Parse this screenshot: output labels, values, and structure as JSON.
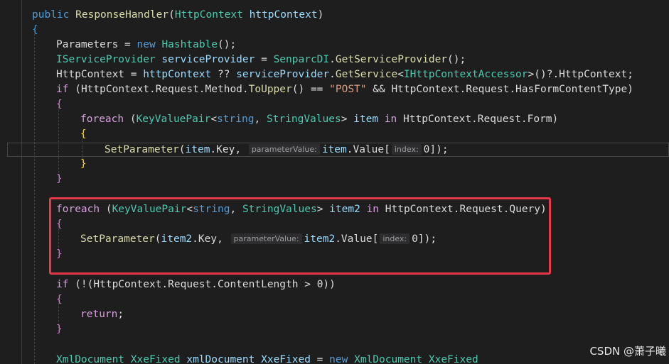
{
  "editor": {
    "line1": {
      "kw": "public",
      "name": "ResponseHandler",
      "open": "(",
      "ptype": "HttpContext",
      "pname": "httpContext",
      "close": ")"
    },
    "line2": "{",
    "line3": {
      "a": "Parameters",
      "eq": " = ",
      "kw": "new",
      "type": "Hashtable",
      "rest": "();"
    },
    "line4": {
      "type": "IServiceProvider",
      "var": "serviceProvider",
      "eq": " = ",
      "cls": "SenparcDI",
      "dot": ".",
      "method": "GetServiceProvider",
      "rest": "();"
    },
    "line5": {
      "a": "HttpContext",
      "eq": " = ",
      "b": "httpContext",
      "op": " ?? ",
      "c": "serviceProvider",
      "dot": ".",
      "method": "GetService",
      "lt": "<",
      "type": "IHttpContextAccessor",
      "gt": ">",
      "rest": "()?.HttpContext;"
    },
    "line6": {
      "kw": "if",
      "open": " (",
      "a": "HttpContext.Request.Method.",
      "method": "ToUpper",
      "paren": "()",
      "op": " == ",
      "str": "\"POST\"",
      "and": " && ",
      "b": "HttpContext.Request.HasFormContentType",
      "close": ")"
    },
    "line7": "{",
    "line8": {
      "kw": "foreach",
      "open": " (",
      "type": "KeyValuePair",
      "lt": "<",
      "t1": "string",
      "comma": ", ",
      "t2": "StringValues",
      "gt": ">",
      "var": " item",
      "in": " in",
      "rest": " HttpContext.Request.Form",
      "close": ")"
    },
    "line9": "{",
    "line10": {
      "method": "SetParameter",
      "open": "(",
      "a": "item",
      "key": ".Key, ",
      "hint1": "parameterValue:",
      "b": "item",
      "val": ".Value",
      "br": "[",
      "hint2": "index:",
      "num": "0",
      "end": "]);"
    },
    "line11": "}",
    "line12": "}",
    "line13": {
      "kw": "foreach",
      "open": " (",
      "type": "KeyValuePair",
      "lt": "<",
      "t1": "string",
      "comma": ", ",
      "t2": "StringValues",
      "gt": ">",
      "var": " item2",
      "in": " in",
      "rest": " HttpContext.Request.Query",
      "close": ")"
    },
    "line14": "{",
    "line15": {
      "method": "SetParameter",
      "open": "(",
      "a": "item2",
      "key": ".Key, ",
      "hint1": "parameterValue:",
      "b": "item2",
      "val": ".Value",
      "br": "[",
      "hint2": "index:",
      "num": "0",
      "end": "]);"
    },
    "line16": "}",
    "line17": {
      "kw": "if",
      "open": " (!(",
      "a": "HttpContext.Request.ContentLength",
      "op": " > ",
      "num": "0",
      "close": "))"
    },
    "line18": "{",
    "line19": {
      "kw": "return",
      "semi": ";"
    },
    "line20": "}",
    "line21": {
      "type": "XmlDocument",
      "sp": " ",
      "a": "XxeFixed",
      "var": " xmlDocument",
      "b": " XxeFixed",
      "eq": " = ",
      "kw": "new",
      "type2": " XmlDocument",
      "c": " XxeFixed"
    }
  },
  "watermark": "CSDN @萧子曦",
  "colors": {
    "background": "#1e1e1e",
    "highlight_box": "#e8394a",
    "keyword": "#569cd6",
    "type": "#4ec9b0",
    "method": "#dcdcaa",
    "parameter": "#9cdcfe",
    "string": "#d69d85"
  }
}
